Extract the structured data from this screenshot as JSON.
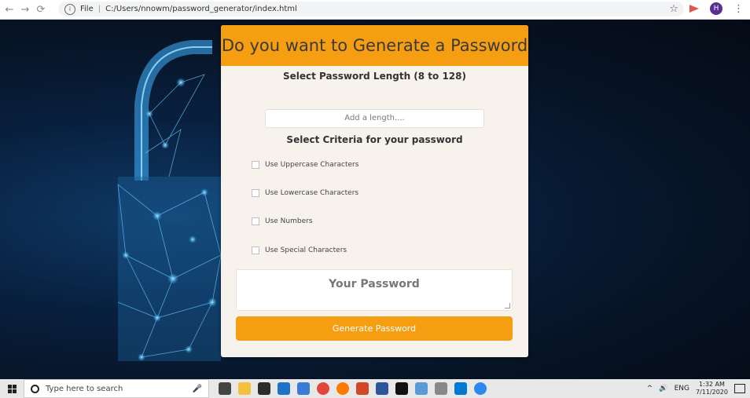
{
  "browser": {
    "file_label": "File",
    "url": "C:/Users/nnowm/password_generator/index.html",
    "profile_initial": "H"
  },
  "card": {
    "header": "Do you want to Generate a Password",
    "length_heading": "Select Password Length (8 to 128)",
    "length_placeholder": "Add a length....",
    "criteria_heading": "Select Criteria for your password",
    "criteria": [
      {
        "label": "Use Uppercase Characters",
        "checked": false
      },
      {
        "label": "Use Lowercase Characters",
        "checked": false
      },
      {
        "label": "Use Numbers",
        "checked": false
      },
      {
        "label": "Use Special Characters",
        "checked": false
      }
    ],
    "password_placeholder": "Your Password",
    "generate_label": "Generate Password"
  },
  "taskbar": {
    "search_placeholder": "Type here to search",
    "language": "ENG",
    "time": "1:32 AM",
    "date": "7/11/2020"
  },
  "colors": {
    "accent": "#f59e12",
    "card_bg": "#f7f3ec",
    "page_bg": "#071426"
  }
}
